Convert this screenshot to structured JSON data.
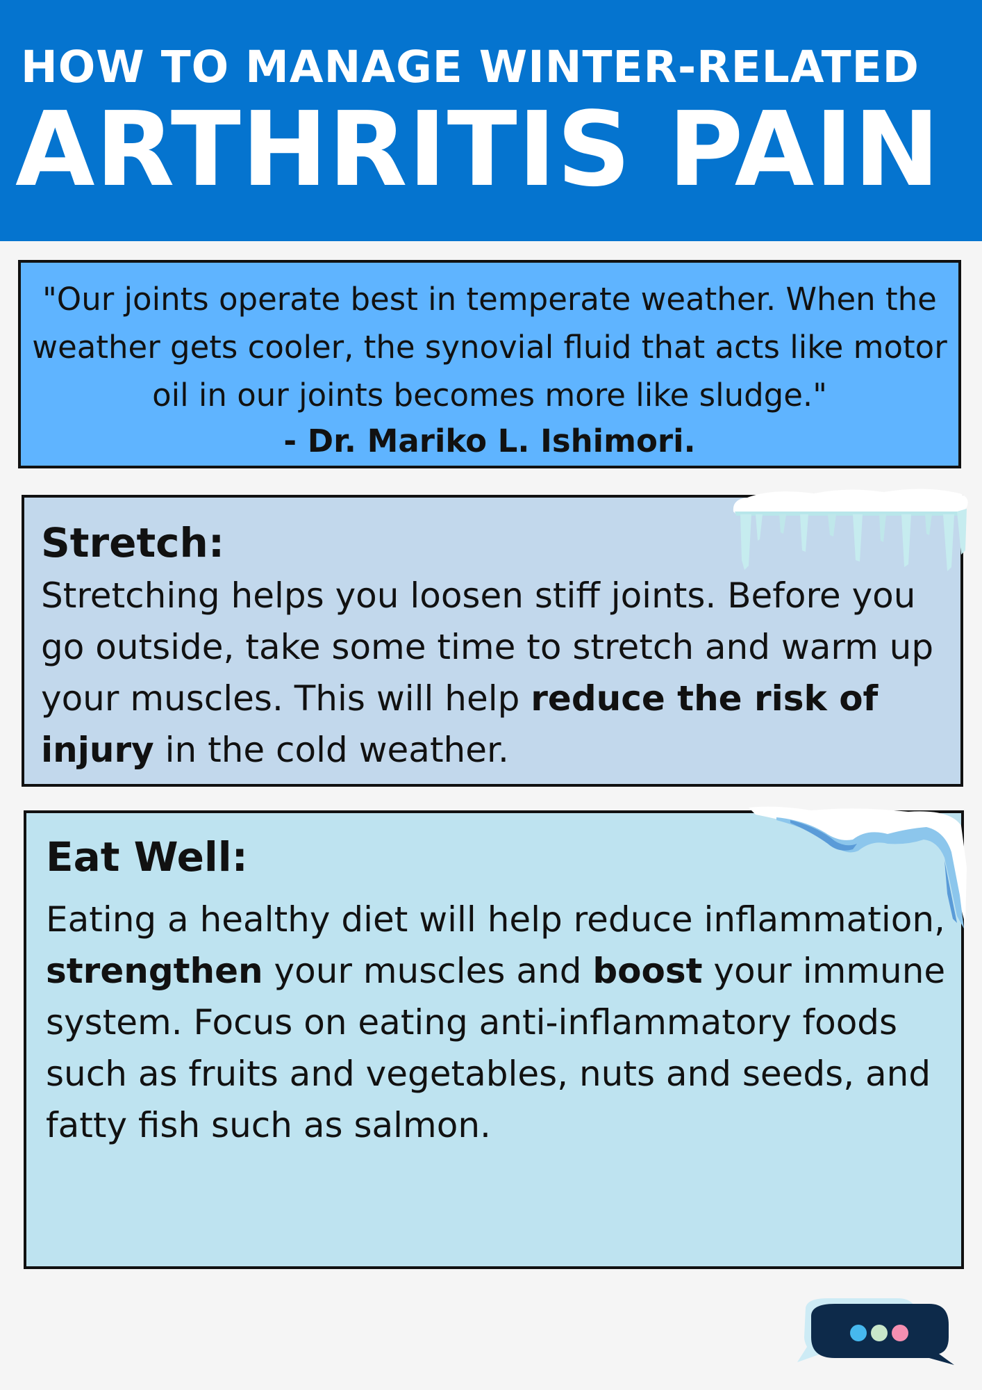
{
  "header": {
    "line1": "HOW TO MANAGE WINTER-RELATED",
    "line2": "ARTHRITIS PAIN"
  },
  "quote": {
    "text": "\"Our joints operate best in temperate weather. When the weather gets cooler, the synovial fluid that acts like motor oil in our joints becomes more like sludge.\"",
    "author": "- Dr. Mariko L. Ishimori."
  },
  "stretch": {
    "title": "Stretch:",
    "body_1": "Stretching helps you loosen stiff joints. Before you go outside, take some time to stretch and warm up your muscles. This will help ",
    "body_bold": "reduce the risk of injury",
    "body_2": " in the cold weather."
  },
  "eat_well": {
    "title": "Eat Well:",
    "body_1": "Eating a healthy diet will help reduce inflammation, ",
    "bold_1": "strengthen",
    "body_2": " your muscles and ",
    "bold_2": "boost",
    "body_3": " your immune system. Focus on eating anti-inflammatory foods such as fruits and vegetables, nuts and seeds, and fatty fish such as salmon."
  },
  "colors": {
    "header_bg": "#0574cf",
    "quote_bg": "#5fb4ff",
    "stretch_bg": "#c2d8ec",
    "eat_bg": "#bee3f0",
    "logo_bubble": "#0d2a4a",
    "logo_dots": [
      "#46b8ee",
      "#c8e6c9",
      "#f48fb1"
    ]
  },
  "icons": {
    "icicles": "icicles-icon",
    "logo": "chat-bubble-logo-icon"
  }
}
